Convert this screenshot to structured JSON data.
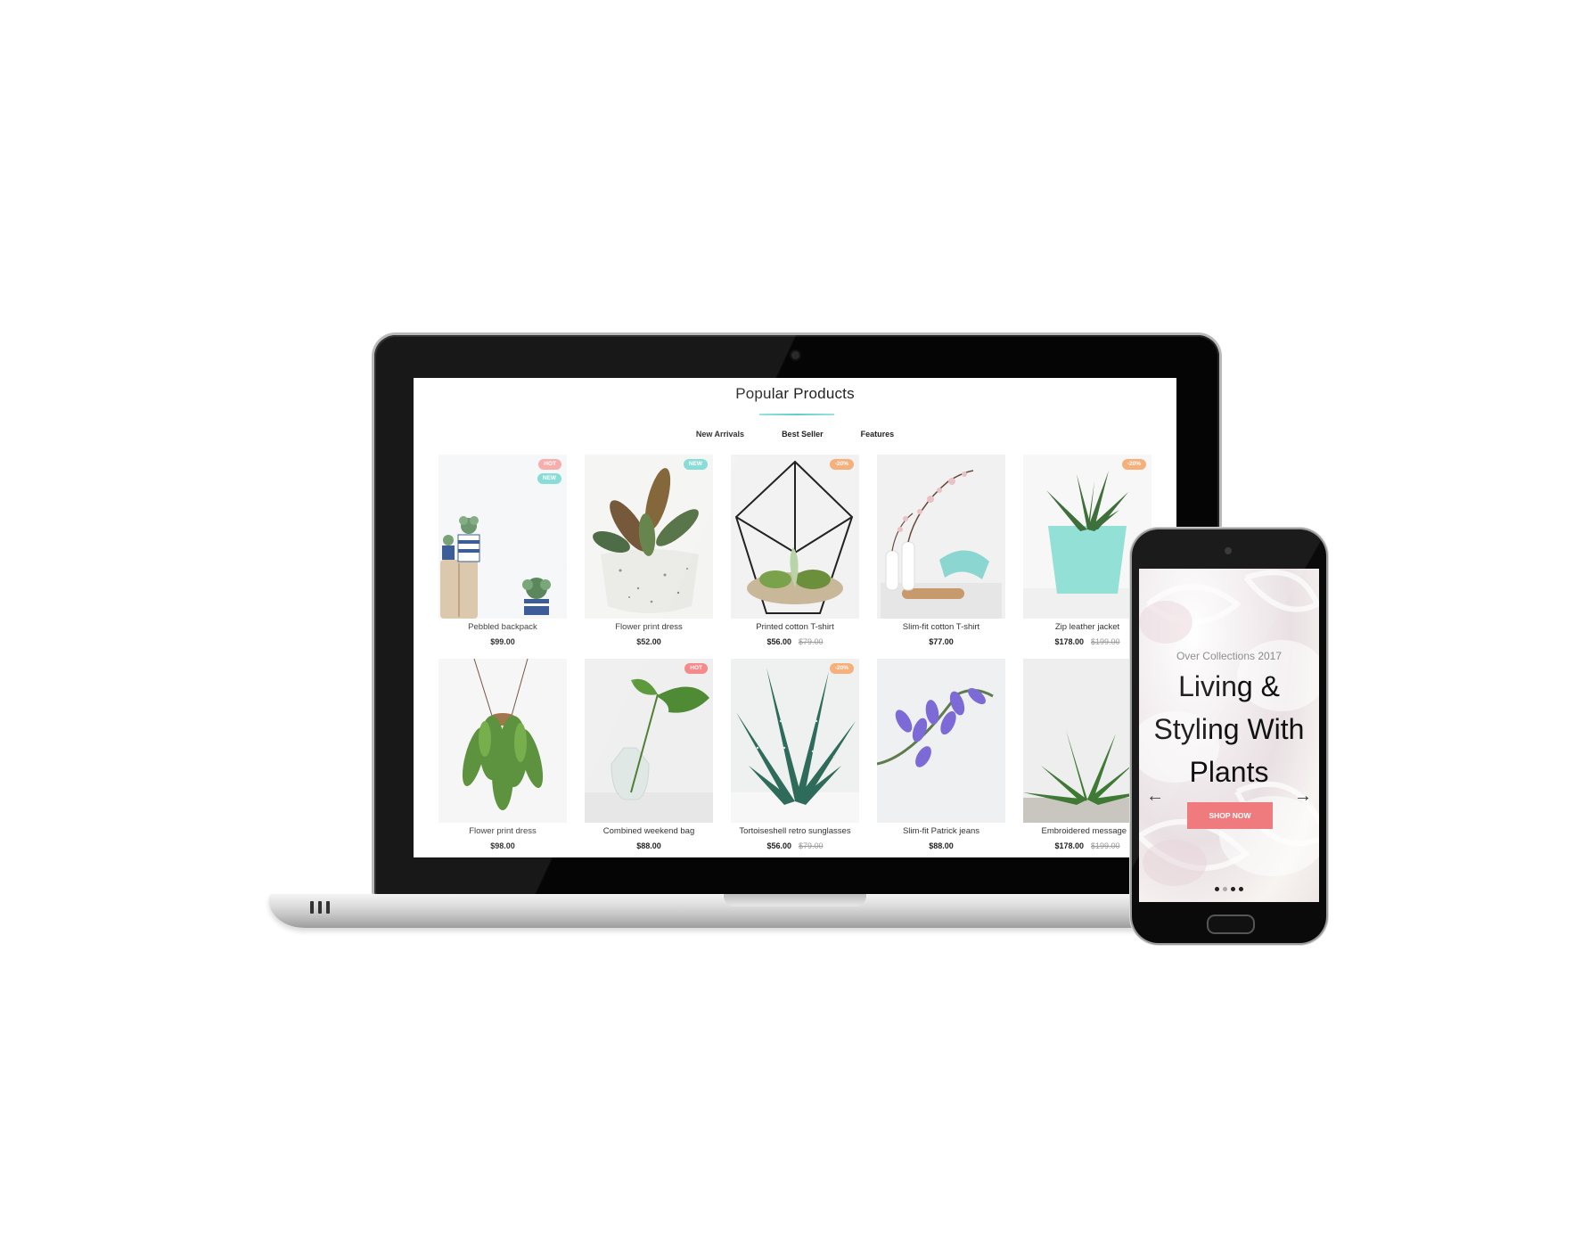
{
  "laptop": {
    "section_title": "Popular Products",
    "tabs": [
      "New Arrivals",
      "Best Seller",
      "Features"
    ],
    "products": [
      {
        "name": "Pebbled backpack",
        "price": "$99.00",
        "old_price": "",
        "badges": [
          {
            "text": "HOT",
            "color": "#f6a7a6"
          },
          {
            "text": "NEW",
            "color": "#7fdad4"
          }
        ]
      },
      {
        "name": "Flower print dress",
        "price": "$52.00",
        "old_price": "",
        "badges": [
          {
            "text": "NEW",
            "color": "#7fdad4"
          }
        ]
      },
      {
        "name": "Printed cotton T-shirt",
        "price": "$56.00",
        "old_price": "$79.00",
        "badges": [
          {
            "text": "-20%",
            "color": "#f6b07c"
          }
        ]
      },
      {
        "name": "Slim-fit cotton T-shirt",
        "price": "$77.00",
        "old_price": "",
        "badges": []
      },
      {
        "name": "Zip leather jacket",
        "price": "$178.00",
        "old_price": "$199.00",
        "badges": [
          {
            "text": "-20%",
            "color": "#f6b07c"
          }
        ]
      },
      {
        "name": "Flower print dress",
        "price": "$98.00",
        "old_price": "",
        "badges": []
      },
      {
        "name": "Combined weekend bag",
        "price": "$88.00",
        "old_price": "",
        "badges": [
          {
            "text": "HOT",
            "color": "#f58a8a"
          }
        ]
      },
      {
        "name": "Tortoiseshell retro sunglasses",
        "price": "$56.00",
        "old_price": "$79.00",
        "badges": [
          {
            "text": "-20%",
            "color": "#f6b07c"
          }
        ]
      },
      {
        "name": "Slim-fit Patrick jeans",
        "price": "$88.00",
        "old_price": "",
        "badges": []
      },
      {
        "name": "Embroidered message c",
        "price": "$178.00",
        "old_price": "$199.00",
        "badges": []
      }
    ]
  },
  "phone": {
    "hero_kicker": "Over Collections 2017",
    "hero_title_lines": [
      "Living &",
      "Styling With",
      "Plants"
    ],
    "cta_label": "SHOP NOW",
    "prev_arrow": "←",
    "next_arrow": "→",
    "slide_count": 4,
    "active_slide": 2
  },
  "icons": {
    "prev": "arrow-left-icon",
    "next": "arrow-right-icon"
  }
}
